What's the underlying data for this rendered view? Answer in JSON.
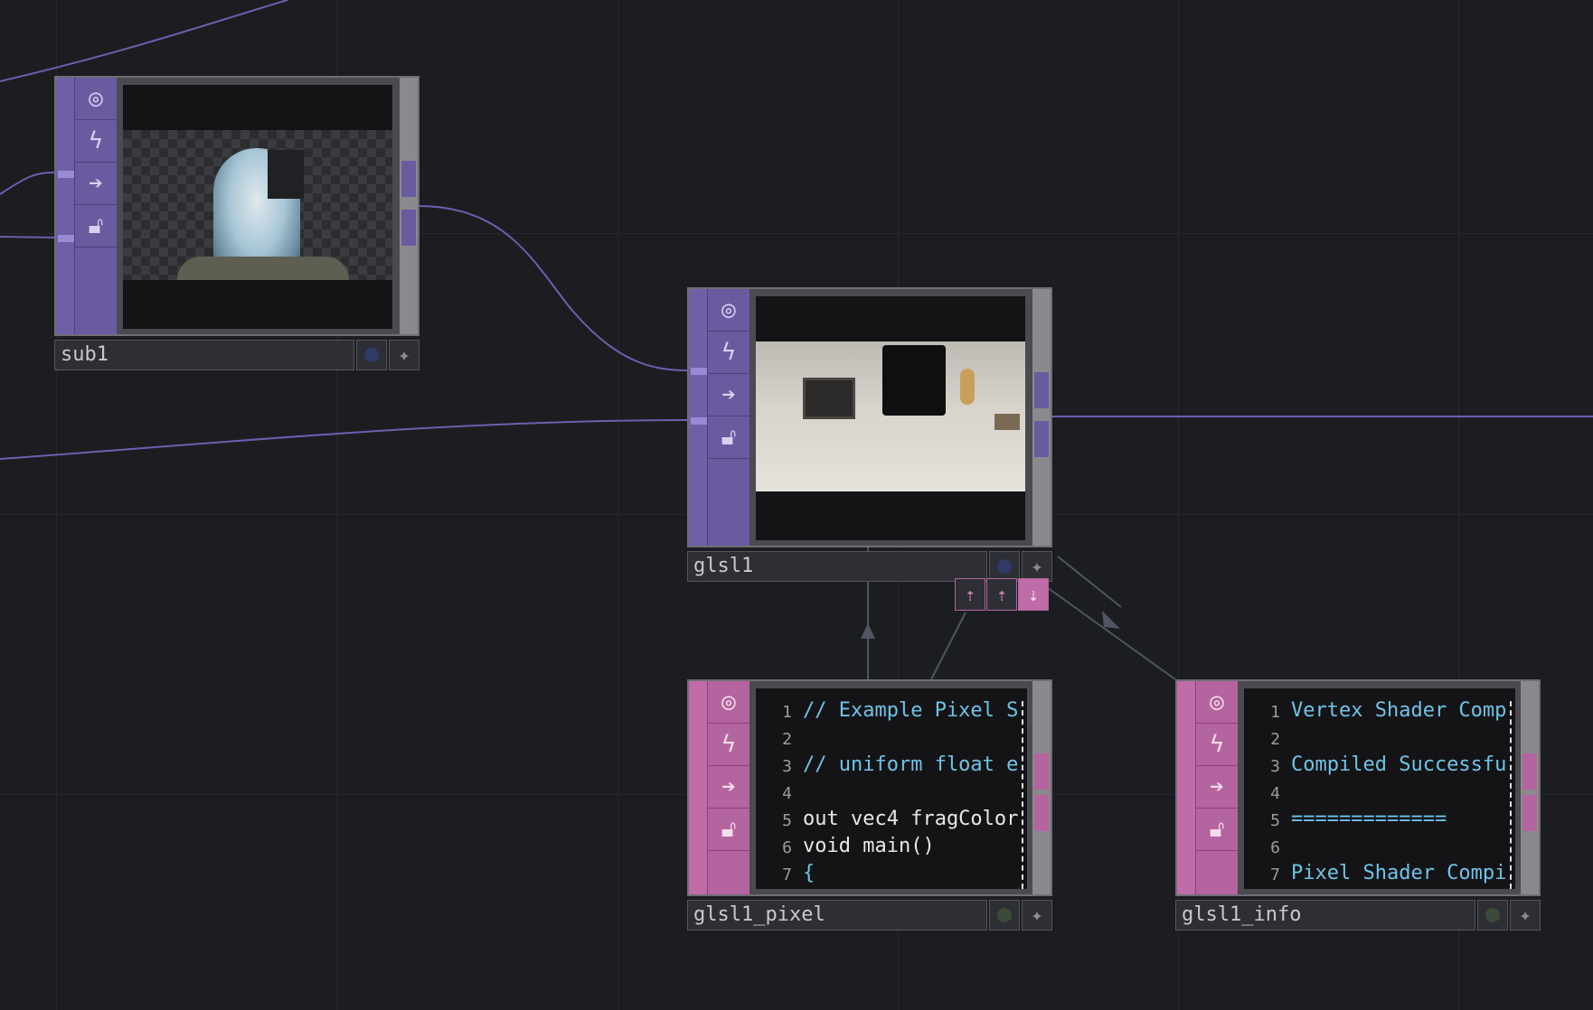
{
  "canvas": {
    "background": "#1c1d21"
  },
  "nodes": {
    "sub1": {
      "name": "sub1",
      "viewer_desc": "",
      "flag_color": "#2f3a66"
    },
    "glsl1": {
      "name": "glsl1",
      "flag_color": "#2f3a66"
    },
    "glsl1_pixel": {
      "name": "glsl1_pixel",
      "flag_color": "#3c4a3a",
      "lines": [
        {
          "n": "1",
          "text": "// Example Pixel S"
        },
        {
          "n": "2",
          "text": ""
        },
        {
          "n": "3",
          "text": "// uniform float e"
        },
        {
          "n": "4",
          "text": ""
        },
        {
          "n": "5",
          "text": "out vec4 fragColor"
        },
        {
          "n": "6",
          "text": "void main()"
        },
        {
          "n": "7",
          "text": "{"
        }
      ]
    },
    "glsl1_info": {
      "name": "glsl1_info",
      "flag_color": "#3c4a3a",
      "lines": [
        {
          "n": "1",
          "text": "Vertex Shader Comp"
        },
        {
          "n": "2",
          "text": ""
        },
        {
          "n": "3",
          "text": "Compiled Successfu"
        },
        {
          "n": "4",
          "text": ""
        },
        {
          "n": "5",
          "text": "============="
        },
        {
          "n": "6",
          "text": ""
        },
        {
          "n": "7",
          "text": "Pixel Shader Compi"
        }
      ]
    }
  },
  "node_icons": [
    "viewer-toggle-icon",
    "cook-icon",
    "bypass-icon",
    "lock-icon"
  ],
  "dock_icons": [
    "dock-up-icon",
    "dock-up-icon",
    "dock-down-icon"
  ],
  "colors": {
    "top_family": "#6a5aa0",
    "dat_family": "#b4649e",
    "wire": "#6d5fb0",
    "code_text": "#6ec4e8"
  }
}
